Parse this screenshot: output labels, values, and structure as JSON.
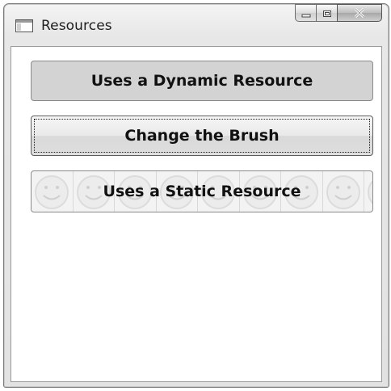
{
  "window": {
    "title": "Resources",
    "controls": {
      "minimize": "minimize-icon",
      "maximize": "maximize-icon",
      "close": "close-icon"
    }
  },
  "buttons": {
    "dynamic_label": "Uses a Dynamic Resource",
    "change_label": "Change the Brush",
    "static_label": "Uses a Static Resource"
  },
  "colors": {
    "dynamic_button_background": "#d3d3d3",
    "static_button_brush": "smiley-tile"
  }
}
